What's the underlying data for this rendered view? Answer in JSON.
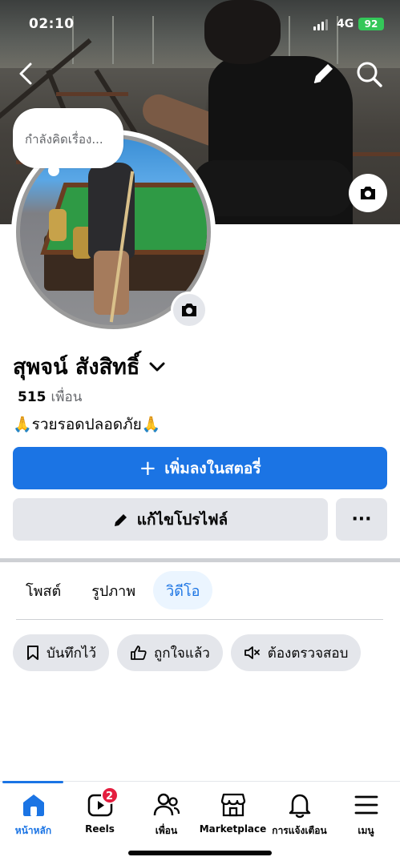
{
  "status_bar": {
    "time": "02:10",
    "network": "4G",
    "battery": "92"
  },
  "cover": {
    "back_icon": "chevron-left-icon",
    "edit_icon": "pencil-icon",
    "search_icon": "search-icon",
    "camera_icon": "camera-icon"
  },
  "avatar": {
    "thought_bubble": "กำลังคิดเรื่อง...",
    "camera_icon": "camera-icon"
  },
  "profile": {
    "name": "สุพจน์ สังสิทธิ์",
    "friends_count": "515",
    "friends_label": "เพื่อน",
    "bio": "🙏รวยรอดปลอดภัย🙏"
  },
  "actions": {
    "add_story": "เพิ่มลงในสตอรี่",
    "edit_profile": "แก้ไขโปรไฟล์",
    "more": "···"
  },
  "tabs": [
    {
      "label": "โพสต์",
      "active": false
    },
    {
      "label": "รูปภาพ",
      "active": false
    },
    {
      "label": "วิดีโอ",
      "active": true
    }
  ],
  "chips": [
    {
      "label": "บันทึกไว้",
      "icon": "bookmark-icon"
    },
    {
      "label": "ถูกใจแล้ว",
      "icon": "thumbs-up-icon"
    },
    {
      "label": "ต้องตรวจสอบ",
      "icon": "mute-icon"
    }
  ],
  "bottom_nav": [
    {
      "label": "หน้าหลัก",
      "icon": "home-icon",
      "active": true
    },
    {
      "label": "Reels",
      "icon": "reels-icon",
      "badge": "2"
    },
    {
      "label": "เพื่อน",
      "icon": "friends-icon"
    },
    {
      "label": "Marketplace",
      "icon": "marketplace-icon"
    },
    {
      "label": "การแจ้งเตือน",
      "icon": "bell-icon"
    },
    {
      "label": "เมนู",
      "icon": "menu-icon"
    }
  ],
  "colors": {
    "accent": "#1b74e4",
    "badge": "#e41e3f",
    "button_gray": "#e4e6eb",
    "battery": "#34c759"
  }
}
